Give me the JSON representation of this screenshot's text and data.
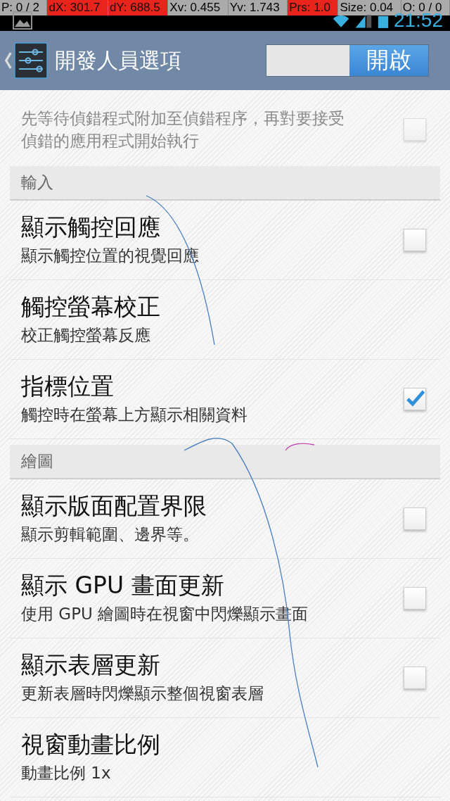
{
  "overlay": [
    {
      "text": "P: 0 / 2",
      "alert": false
    },
    {
      "text": "dX: 301.7",
      "alert": true
    },
    {
      "text": "dY: 688.5",
      "alert": true
    },
    {
      "text": "Xv: 0.455",
      "alert": false
    },
    {
      "text": "Yv: 1.743",
      "alert": false
    },
    {
      "text": "Prs: 1.0",
      "alert": true
    },
    {
      "text": "Size: 0.04",
      "alert": false
    },
    {
      "text": "O: 0 / 0",
      "alert": false
    }
  ],
  "status_bar": {
    "time": "21:52"
  },
  "action_bar": {
    "title": "開發人員選項",
    "switch": {
      "label": "開啟",
      "on": true
    }
  },
  "items": [
    {
      "kind": "checkbox",
      "summary": "先等待偵錯程式附加至偵錯程序，再對要接受偵錯的應用程式開始執行",
      "checked": false,
      "disabled": true
    },
    {
      "kind": "category",
      "title": "輸入"
    },
    {
      "kind": "checkbox",
      "title": "顯示觸控回應",
      "summary": "顯示觸控位置的視覺回應",
      "checked": false,
      "disabled": false
    },
    {
      "kind": "plain",
      "title": "觸控螢幕校正",
      "summary": "校正觸控螢幕反應"
    },
    {
      "kind": "checkbox",
      "title": "指標位置",
      "summary": "觸控時在螢幕上方顯示相關資料",
      "checked": true,
      "disabled": false
    },
    {
      "kind": "category",
      "title": "繪圖"
    },
    {
      "kind": "checkbox",
      "title": "顯示版面配置界限",
      "summary": "顯示剪輯範圍、邊界等。",
      "checked": false,
      "disabled": false
    },
    {
      "kind": "checkbox",
      "title": "顯示 GPU 畫面更新",
      "summary": "使用 GPU 繪圖時在視窗中閃爍顯示畫面",
      "checked": false,
      "disabled": false
    },
    {
      "kind": "checkbox",
      "title": "顯示表層更新",
      "summary": "更新表層時閃爍顯示整個視窗表層",
      "checked": false,
      "disabled": false
    },
    {
      "kind": "plain",
      "title": "視窗動畫比例",
      "summary": "動畫比例 1x"
    }
  ]
}
